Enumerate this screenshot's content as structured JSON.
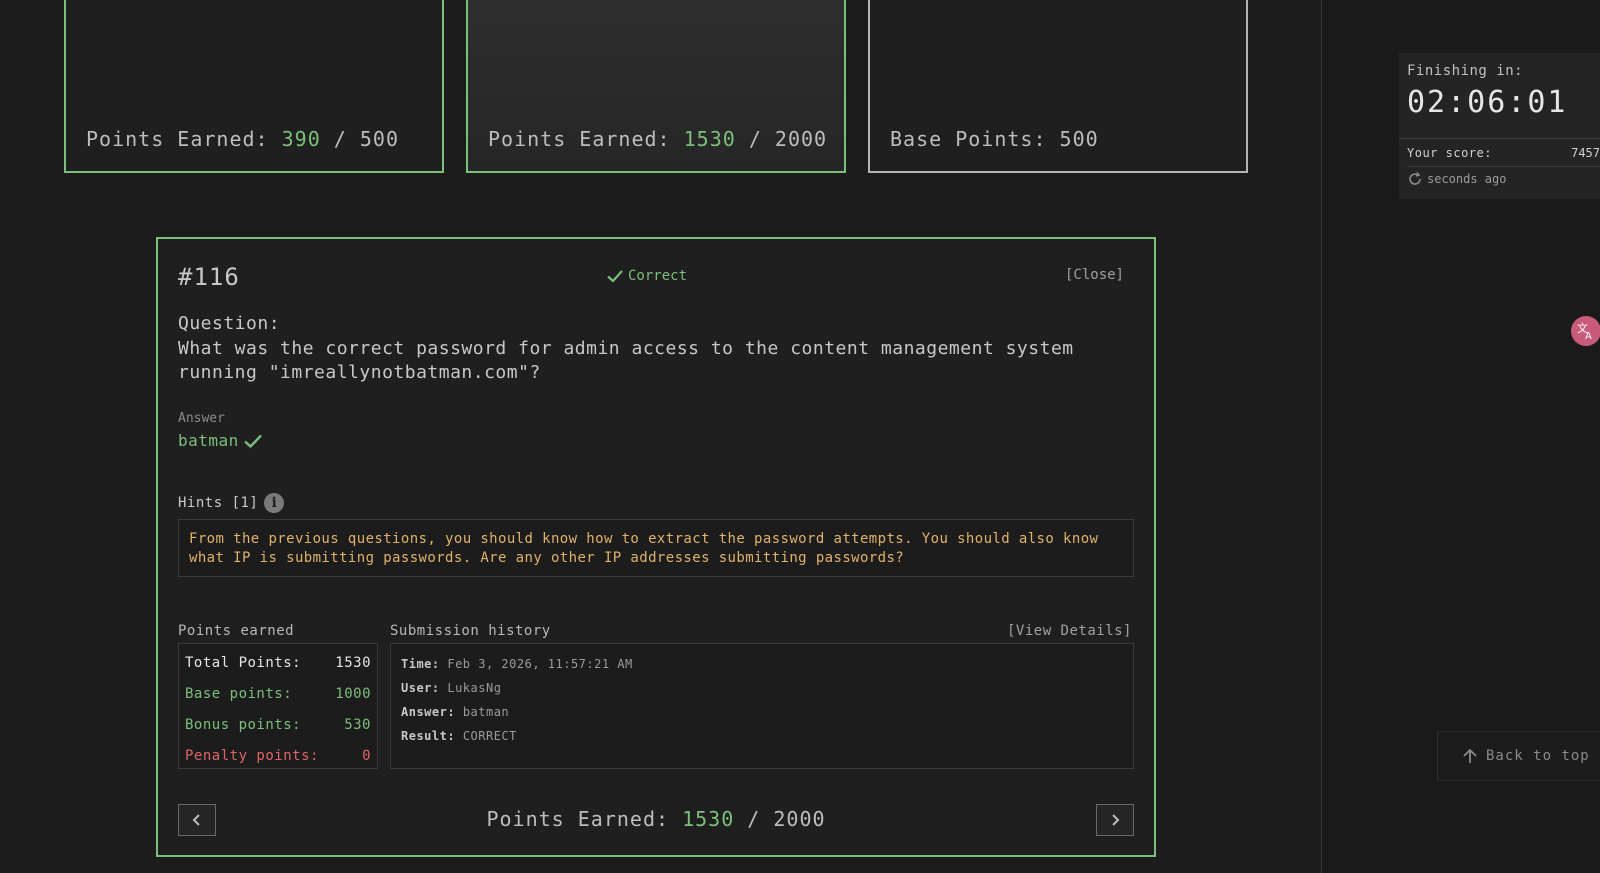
{
  "cards": [
    {
      "label": "Points Earned: ",
      "earned": "390",
      "total": " / 500"
    },
    {
      "label": "Points Earned: ",
      "earned": "1530",
      "total": " / 2000"
    },
    {
      "label": "Base Points: 500"
    }
  ],
  "modal": {
    "id": "#116",
    "status": "Correct",
    "close_label": "[Close]",
    "question_label": "Question:",
    "question_text": "What was the correct password for admin access to the content management system running \"imreallynotbatman.com\"?",
    "answer_label": "Answer",
    "answer_value": "batman",
    "hints_label": "Hints [1]",
    "hint_text": "From the previous questions, you should know how to extract the password attempts. You should also know what IP is submitting passwords. Are any other IP addresses submitting passwords?",
    "points_earned_label": "Points earned",
    "points": [
      {
        "label": "Total Points:",
        "value": "1530"
      },
      {
        "label": "Base points:",
        "value": "1000"
      },
      {
        "label": "Bonus points:",
        "value": "530"
      },
      {
        "label": "Penalty points:",
        "value": "0"
      }
    ],
    "submission_label": "Submission history",
    "view_details_label": "[View Details]",
    "submission": [
      {
        "key": "Time:",
        "value": "Feb 3, 2026, 11:57:21 AM"
      },
      {
        "key": "User:",
        "value": "LukasNg"
      },
      {
        "key": "Answer:",
        "value": "batman"
      },
      {
        "key": "Result:",
        "value": "CORRECT"
      }
    ],
    "footer": {
      "label": "Points Earned: ",
      "earned": "1530",
      "total": " / 2000"
    }
  },
  "timer": {
    "label": "Finishing in:",
    "time": "02:06:01",
    "score_label": "Your score:",
    "score_value": "7457",
    "refresh_text": "seconds ago"
  },
  "back_to_top": "Back to top",
  "icons": {
    "check": "check-icon",
    "info": "info-icon",
    "refresh": "refresh-icon",
    "chevron_left": "chevron-left-icon",
    "chevron_right": "chevron-right-icon",
    "arrow_up": "arrow-up-icon",
    "translate": "translate-icon"
  },
  "colors": {
    "accent_green": "#7bbf7b",
    "hint_amber": "#e0b26a",
    "penalty_red": "#e06464",
    "background": "#1c1c1c"
  }
}
